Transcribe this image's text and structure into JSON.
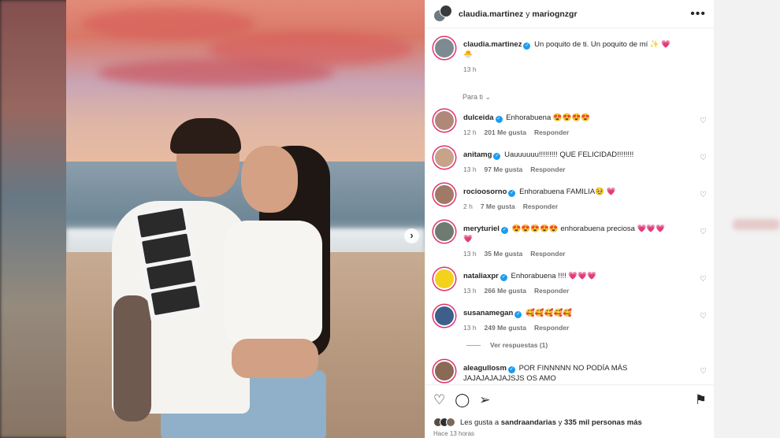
{
  "header": {
    "user1": "claudia.martinez",
    "connector": "y",
    "user2": "mariognzgr",
    "more": "•••"
  },
  "caption": {
    "username": "claudia.martinez",
    "text": "Un poquito de ti. Un poquito de mí ✨ 💗",
    "text2": "🐣",
    "time": "13 h"
  },
  "sort_label": "Para ti ⌄",
  "comments": [
    {
      "user": "dulceida",
      "text": "Enhorabuena 😍😍😍😍",
      "time": "12 h",
      "likes": "201 Me gusta",
      "reply": "Responder",
      "avatar": "#b0887a"
    },
    {
      "user": "anitamg",
      "text": "Uauuuuuu!!!!!!!!! QUE FELICIDAD!!!!!!!!",
      "time": "13 h",
      "likes": "97 Me gusta",
      "reply": "Responder",
      "avatar": "#c9a28a"
    },
    {
      "user": "rocioosorno",
      "text": "Enhorabuena FAMILIA🥹 💗",
      "time": "2 h",
      "likes": "7 Me gusta",
      "reply": "Responder",
      "avatar": "#a07a66"
    },
    {
      "user": "meryturiel",
      "text": "😍😍😍😍😍 enhorabuena preciosa 💗💗💗",
      "text2": "💗",
      "time": "13 h",
      "likes": "35 Me gusta",
      "reply": "Responder",
      "avatar": "#6d7b70"
    },
    {
      "user": "nataliaxpr",
      "text": "Enhorabuena !!!! 💗💗💗",
      "time": "13 h",
      "likes": "266 Me gusta",
      "reply": "Responder",
      "avatar": "#f2d21b"
    },
    {
      "user": "susanamegan",
      "text": "🥰🥰🥰🥰🥰",
      "time": "13 h",
      "likes": "249 Me gusta",
      "reply": "Responder",
      "avatar": "#3d5f8a"
    },
    {
      "user": "aleagullosm",
      "text": "POR FINNNNN NO PODÍA MÁS",
      "text2": "JAJAJAJAJAJSJS OS AMO",
      "avatar": "#8a6a55"
    }
  ],
  "view_replies": "Ver respuestas (1)",
  "likes_line": {
    "prefix": "Les gusta a",
    "user": "sandraandarias",
    "middle": "y",
    "count": "335 mil personas más"
  },
  "time_ago": "Hace 13 horas",
  "icons": {
    "heart": "♡",
    "comment": "◯",
    "share": "➢",
    "save": "⚑",
    "next": "›",
    "verified": "✓"
  }
}
